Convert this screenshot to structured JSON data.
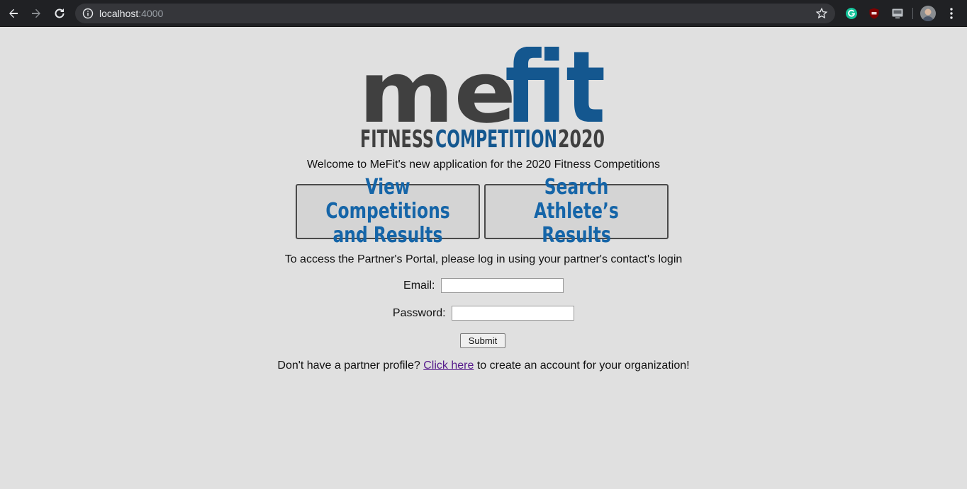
{
  "browser": {
    "url_host": "localhost",
    "url_port": ":4000"
  },
  "logo": {
    "word_gray": "me",
    "word_blue": "fit",
    "tagline_gray": "FITNESS",
    "tagline_blue": "COMPETITION",
    "tagline_year": "2020",
    "gray_color": "#404040",
    "blue_color": "#14578f"
  },
  "welcome_text": "Welcome to MeFit's new application for the 2020 Fitness Competitions",
  "buttons": {
    "view_label": "View Competitions\nand Results",
    "search_label": "Search Athlete’s\nResults"
  },
  "portal_text": "To access the Partner's Portal, please log in using your partner's contact's login",
  "form": {
    "email_label": "Email:",
    "email_value": "",
    "password_label": "Password:",
    "password_value": "",
    "submit_label": "Submit"
  },
  "signup": {
    "prefix": "Don't have a partner profile? ",
    "link_text": "Click here",
    "suffix": " to create an account for your organization!"
  }
}
